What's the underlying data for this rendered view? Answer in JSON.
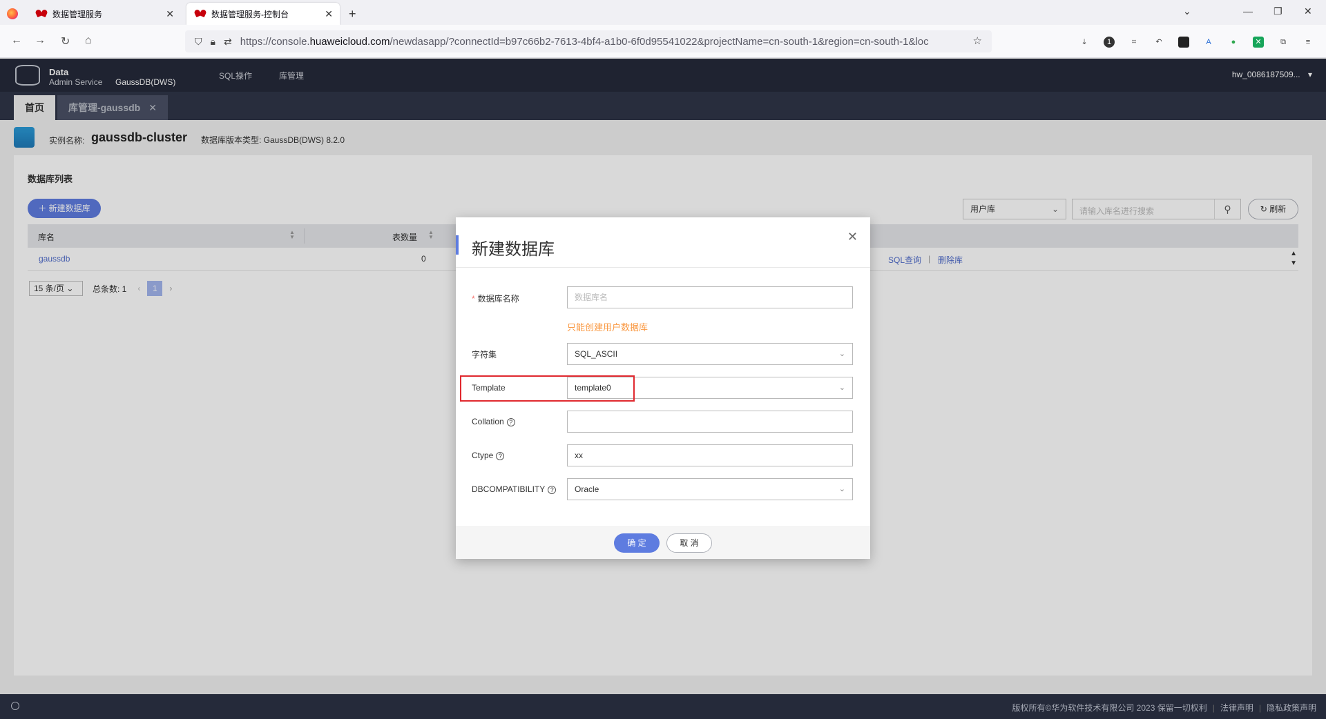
{
  "browser": {
    "tabs": [
      {
        "title": "数据管理服务"
      },
      {
        "title": "数据管理服务-控制台"
      }
    ],
    "url_prefix": "https://console.",
    "url_domain": "huaweicloud.com",
    "url_rest": "/newdasapp/?connectId=b97c66b2-7613-4bf4-a1b0-6f0d95541022&projectName=cn-south-1&region=cn-south-1&loc"
  },
  "app": {
    "brand_line1": "Data",
    "brand_line2": "Admin Service",
    "engine": "GaussDB(DWS)",
    "menu": [
      "SQL操作",
      "库管理"
    ],
    "user": "hw_0086187509..."
  },
  "page_tabs": {
    "home": "首页",
    "lib": "库管理-gaussdb"
  },
  "instance": {
    "label": "实例名称:",
    "name": "gaussdb-cluster",
    "dbtype": "数据库版本类型:  GaussDB(DWS) 8.2.0"
  },
  "list": {
    "title": "数据库列表",
    "new_button": "新建数据库",
    "filter_value": "用户库",
    "search_placeholder": "请输入库名进行搜索",
    "refresh": "刷新",
    "columns": [
      "库名",
      "表数量"
    ],
    "rows": [
      {
        "name": "gaussdb",
        "tables": "0",
        "actions": [
          "SQL查询",
          "删除库"
        ]
      }
    ],
    "pager": {
      "page_size": "15 条/页",
      "total": "总条数:  1",
      "current": "1"
    }
  },
  "modal": {
    "title": "新建数据库",
    "fields": {
      "name_label": "数据库名称",
      "name_placeholder": "数据库名",
      "name_hint": "只能创建用户数据库",
      "charset_label": "字符集",
      "charset_value": "SQL_ASCII",
      "template_label": "Template",
      "template_value": "template0",
      "collation_label": "Collation",
      "collation_value": "",
      "ctype_label": "Ctype",
      "ctype_value": "xx",
      "dbcompat_label": "DBCOMPATIBILITY",
      "dbcompat_value": "Oracle"
    },
    "ok": "确 定",
    "cancel": "取 消"
  },
  "footer": {
    "copyright": "版权所有©华为软件技术有限公司 2023 保留一切权利",
    "legal": "法律声明",
    "privacy": "隐私政策声明"
  },
  "colors": {
    "accent": "#5e7ce0",
    "header": "#252a3a",
    "highlight": "#e0282e",
    "warning": "#fa9841"
  }
}
